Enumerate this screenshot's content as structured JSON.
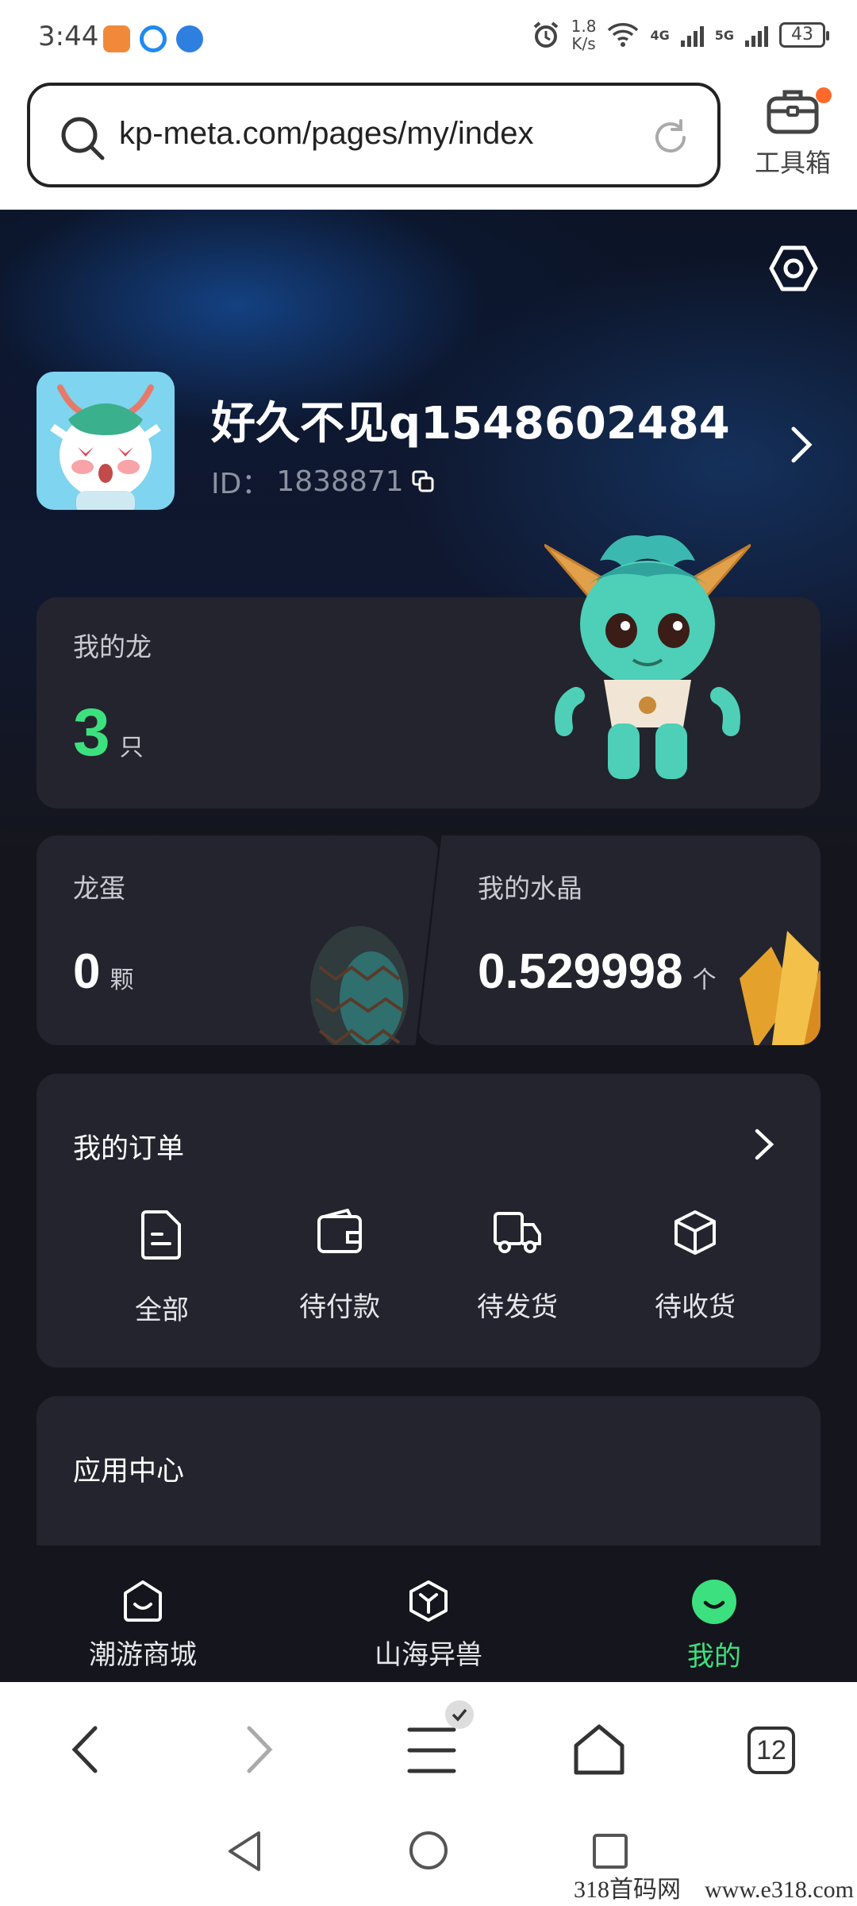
{
  "status_bar": {
    "time": "3:44",
    "speed": "1.8",
    "speed_unit": "K/s",
    "net1": "4G",
    "net2": "5G",
    "battery": "43"
  },
  "browser": {
    "url": "kp-meta.com/pages/my/index",
    "toolbox_label": "工具箱"
  },
  "profile": {
    "username": "好久不见q1548602484",
    "id_label": "ID：",
    "id_value": "1838871"
  },
  "dragon_card": {
    "title": "我的龙",
    "count": "3",
    "unit": "只"
  },
  "egg_card": {
    "title": "龙蛋",
    "count": "0",
    "unit": "颗"
  },
  "crystal_card": {
    "title": "我的水晶",
    "count": "0.529998",
    "unit": "个"
  },
  "orders": {
    "title": "我的订单",
    "items": [
      {
        "label": "全部",
        "icon": "document-icon"
      },
      {
        "label": "待付款",
        "icon": "wallet-icon"
      },
      {
        "label": "待发货",
        "icon": "truck-icon"
      },
      {
        "label": "待收货",
        "icon": "box-icon"
      }
    ]
  },
  "apps": {
    "title": "应用中心"
  },
  "tabs": [
    {
      "label": "潮游商城",
      "icon": "shop-icon",
      "active": false
    },
    {
      "label": "山海异兽",
      "icon": "cube-icon",
      "active": false
    },
    {
      "label": "我的",
      "icon": "smile-icon",
      "active": true
    }
  ],
  "browser_nav": {
    "tab_count": "12"
  },
  "watermark": "318首码网　www.e318.com",
  "colors": {
    "accent": "#3de07e",
    "card": "#23242d",
    "background": "#15161d",
    "notify_dot": "#ff6a2a"
  }
}
